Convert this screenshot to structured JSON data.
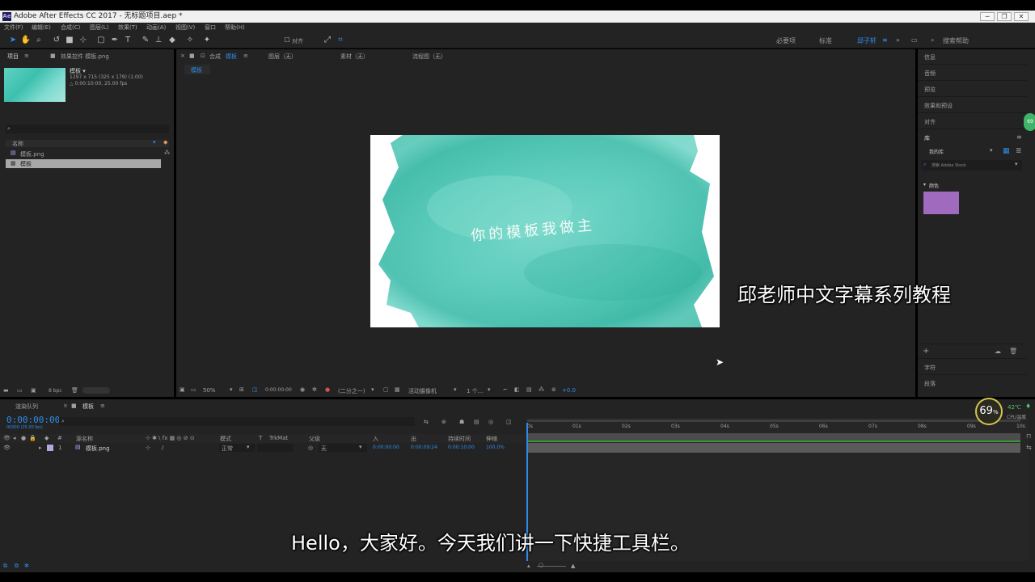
{
  "window": {
    "title": "Adobe After Effects CC 2017 - 无标题项目.aep *",
    "app_icon": "Ae",
    "buttons": [
      "─",
      "❐",
      "✕"
    ]
  },
  "menu": [
    "文件(F)",
    "编辑(E)",
    "合成(C)",
    "图层(L)",
    "效果(T)",
    "动画(A)",
    "视图(V)",
    "窗口",
    "帮助(H)"
  ],
  "toolbar": {
    "align_label": "对齐",
    "workspaces": [
      "必要项",
      "标准",
      "邱子轩"
    ],
    "active_workspace": "邱子轩",
    "search_placeholder": "搜索帮助"
  },
  "project_panel": {
    "tab_project": "项目",
    "tab_effects": "效果控件 模板.png",
    "item_name": "模板 ▾",
    "item_info_1": "1297 x 715  (325 x 179) (1.00)",
    "item_info_2": "△ 0:00:10:00, 25.00 fps",
    "col_name": "名称",
    "items": [
      "模板.png",
      "模板"
    ],
    "bpc": "8 bpc"
  },
  "comp_panel": {
    "tab_comp": "合成",
    "comp_name": "模板",
    "tab_layer": "图层（无）",
    "tab_footage": "素材（无）",
    "tab_flowchart": "流程图（无）",
    "sub_tab": "模板",
    "preview_text": "你的模板我做主",
    "zoom": "50%",
    "timecode": "0:00:00:00",
    "resolution": "(二分之一)",
    "camera": "活动摄像机",
    "views": "1 个...",
    "exposure": "+0.0"
  },
  "right_panel": {
    "items": [
      "信息",
      "音频",
      "预览",
      "效果和预设",
      "对齐"
    ],
    "library": "库",
    "library_select": "我的库",
    "stock_search": "搜索 Adobe Stock",
    "colors_section": "颜色",
    "swatch_color": "#a06bbf",
    "bottom_items": [
      "字符",
      "段落"
    ]
  },
  "timeline": {
    "tab_render": "渲染队列",
    "tab_comp": "模板",
    "timecode": "0:00:00:00",
    "frame_info": "00000 (25.00 fps)",
    "col_source": "源名称",
    "col_mode": "模式",
    "col_trkmat": "TrkMat",
    "col_parent": "父级",
    "col_in": "入",
    "col_out": "出",
    "col_duration": "持续时间",
    "col_stretch": "伸缩",
    "layer": {
      "num": "1",
      "name": "模板.png",
      "mode": "正常",
      "parent": "无",
      "in": "0:00:00:00",
      "out": "0:00:09:24",
      "duration": "0:00:10:00",
      "stretch": "100.0%"
    },
    "ruler": [
      "0s",
      "01s",
      "02s",
      "03s",
      "04s",
      "05s",
      "06s",
      "07s",
      "08s",
      "09s",
      "10s"
    ]
  },
  "cpu_widget": {
    "percent": "69",
    "temp": "42℃",
    "label": "CPU温度",
    "side_badge": "69"
  },
  "overlay": {
    "series_title": "邱老师中文字幕系列教程",
    "subtitle": "Hello，大家好。今天我们讲一下快捷工具栏。"
  },
  "colors": {
    "accent": "#2d8ceb",
    "panel": "#232323",
    "dark": "#1d1d1d",
    "layer_bar": "#5a5a5a",
    "work_area": "#3a9a3a"
  }
}
